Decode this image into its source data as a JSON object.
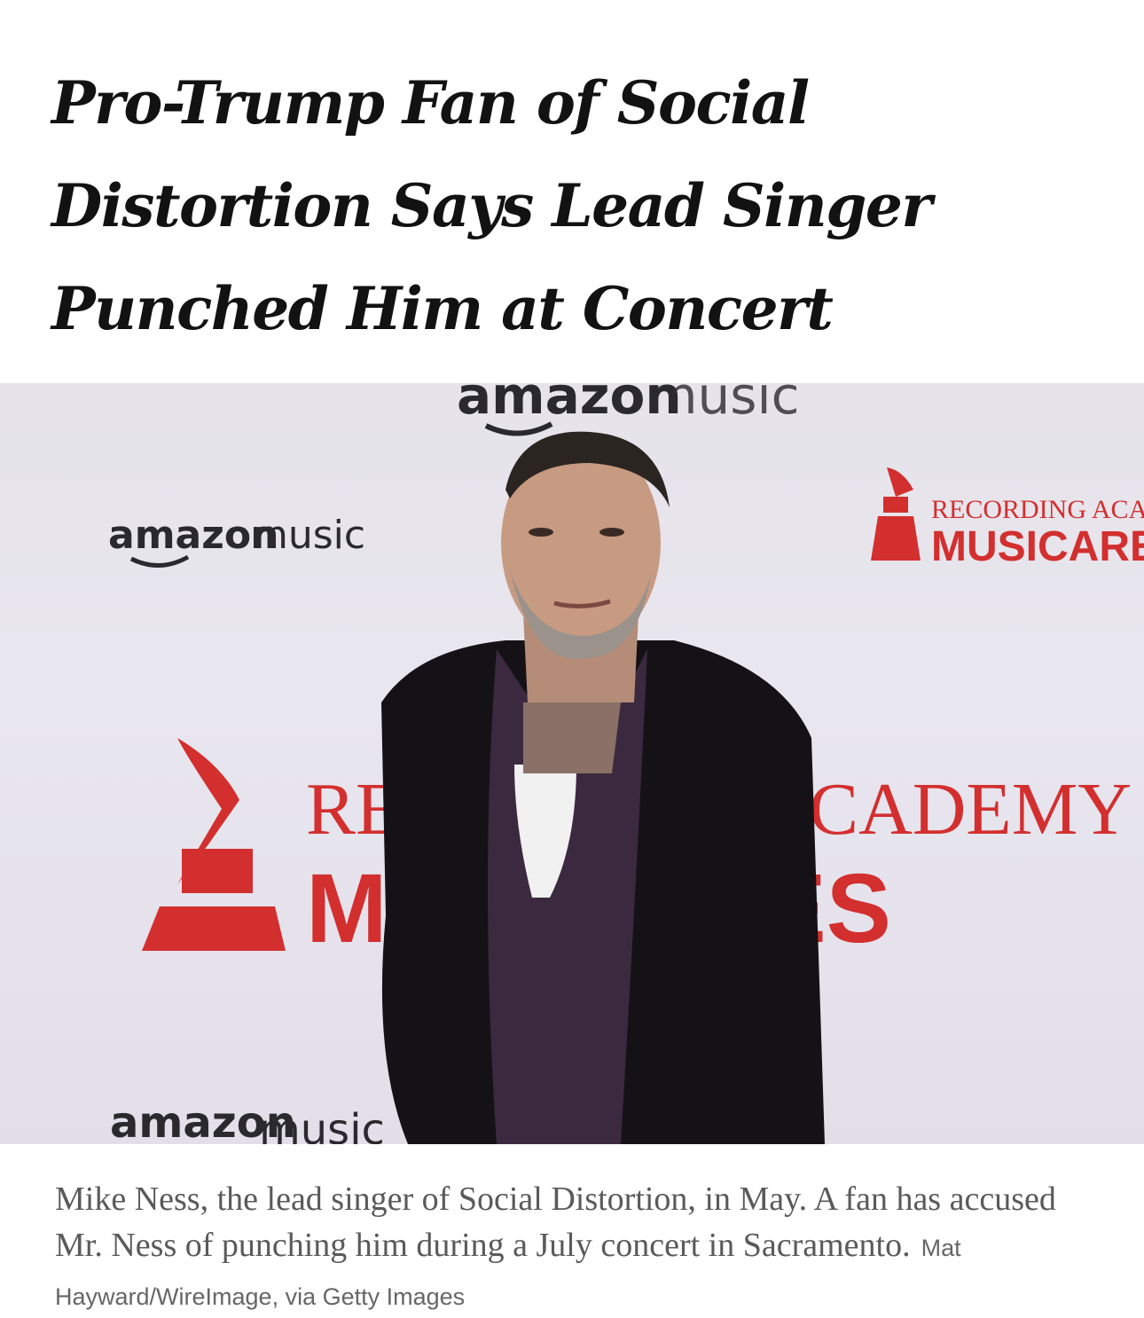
{
  "article": {
    "headline": "Pro-Trump Fan of Social Distortion Says Lead Singer Punched Him at Concert",
    "caption": "Mike Ness, the lead singer of Social Distortion, in May. A fan has accused Mr. Ness of punching him during a July concert in Sacramento.",
    "credit": "Mat Hayward/WireImage, via Getty Images"
  },
  "backdrop": {
    "logo_amazon_word": "amazon",
    "logo_music_word": "music",
    "recording_academy": "RECORDING ACADEMY",
    "musicares": "MUSICARES",
    "colors": {
      "backdrop": "#e6e3ea",
      "musicares_red": "#d32f2f",
      "amazon_dark": "#232f3e",
      "jacket": "#141216",
      "shirt": "#3b2a3f"
    }
  }
}
